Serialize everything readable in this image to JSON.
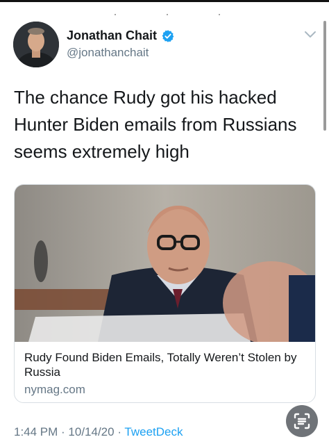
{
  "tweet": {
    "author_name": "Jonathan Chait",
    "author_handle": "@jonathanchait",
    "text": "The chance Rudy got his hacked\nHunter Biden emails from Russians\nseems extremely high",
    "time": "1:44 PM",
    "date": "10/14/20",
    "source": "TweetDeck",
    "separator": " · "
  },
  "card": {
    "title": "Rudy Found Biden Emails, Totally Weren’t Stolen by Russia",
    "domain": "nymag.com"
  },
  "colors": {
    "accent": "#1da1f2",
    "secondary_text": "#657786",
    "primary_text": "#14171a"
  },
  "icons": {
    "verified": "verified-badge-icon",
    "caret": "chevron-down-icon",
    "scan": "scan-text-icon"
  }
}
